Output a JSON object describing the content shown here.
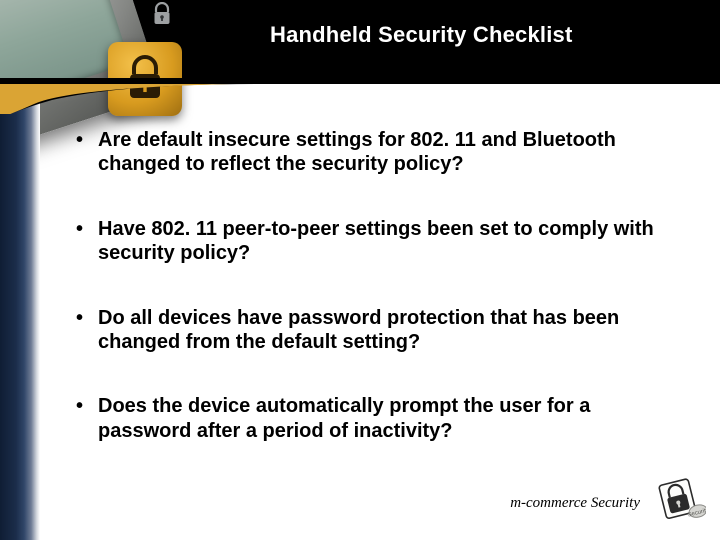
{
  "title": "Handheld Security Checklist",
  "bullets": [
    "Are default insecure settings for 802. 11 and Bluetooth changed to reflect the security policy?",
    "Have 802. 11 peer-to-peer settings been set to comply with security policy?",
    "Do all devices have password protection that has been changed from the default setting?",
    "Does the device automatically prompt the user for a password after a period of inactivity?"
  ],
  "footer": "m-commerce Security"
}
